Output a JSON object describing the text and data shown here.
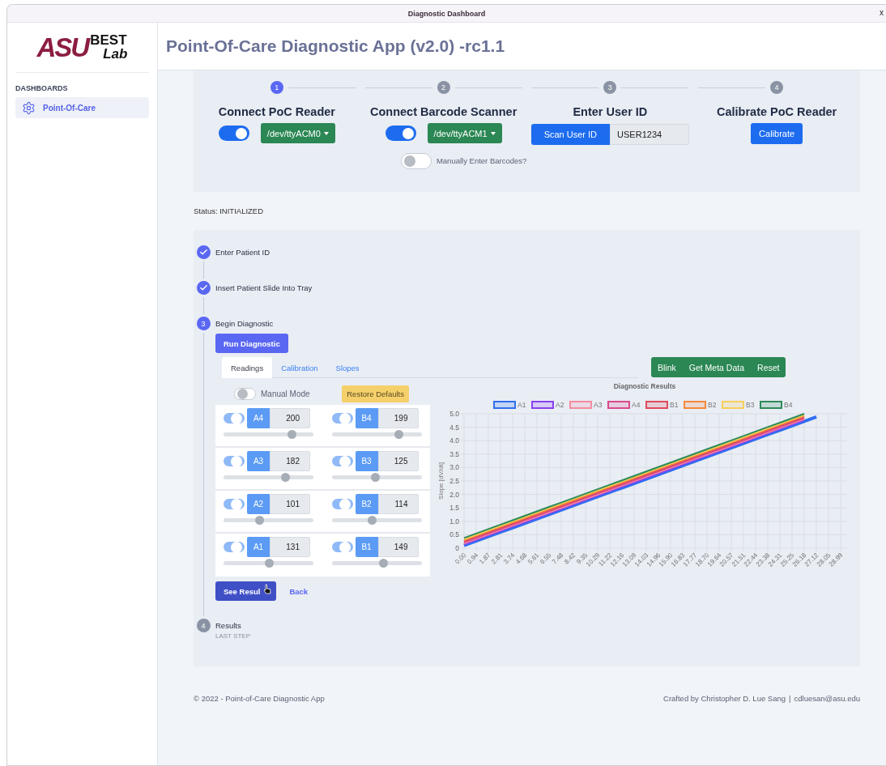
{
  "window": {
    "title": "Diagnostic Dashboard",
    "close": "x"
  },
  "sidebar": {
    "logo": {
      "parts": [
        "ASU",
        "BEST",
        "Lab"
      ]
    },
    "section": "DASHBOARDS",
    "items": [
      {
        "label": "Point-Of-Care",
        "selected": true
      }
    ]
  },
  "header": {
    "title": "Point-Of-Care Diagnostic App (v2.0) -rc1.1"
  },
  "setup_steps": [
    {
      "number": "1",
      "title": "Connect PoC Reader",
      "selected": true,
      "kind": "device",
      "toggle_on": true,
      "port": "/dev/ttyACM0"
    },
    {
      "number": "2",
      "title": "Connect Barcode Scanner",
      "selected": false,
      "kind": "device",
      "toggle_on": true,
      "port": "/dev/ttyACM1",
      "manual": {
        "label": "Manually Enter Barcodes?",
        "on": false
      }
    },
    {
      "number": "3",
      "title": "Enter User ID",
      "selected": false,
      "kind": "user",
      "button": "Scan User ID",
      "value": "USER1234"
    },
    {
      "number": "4",
      "title": "Calibrate PoC Reader",
      "selected": false,
      "kind": "calibrate",
      "button": "Calibrate"
    }
  ],
  "status": "Status: INITIALIZED",
  "progress": [
    {
      "label": "Enter Patient ID",
      "done": true,
      "active": false
    },
    {
      "label": "Insert Patient Slide Into Tray",
      "done": true,
      "active": false
    },
    {
      "number": "3",
      "label": "Begin Diagnostic",
      "done": false,
      "active": true
    },
    {
      "number": "4",
      "label": "Results",
      "sublabel": "LAST STEP",
      "done": false,
      "active": false
    }
  ],
  "diagnostic": {
    "run_button": "Run Diagnostic",
    "tabs": [
      {
        "label": "Readings",
        "selected": true
      },
      {
        "label": "Calibration",
        "selected": false
      },
      {
        "label": "Slopes",
        "selected": false
      }
    ],
    "actions": [
      "Blink",
      "Get Meta Data",
      "Reset"
    ],
    "manual_mode": {
      "label": "Manual Mode",
      "on": false
    },
    "restore_button": "Restore Defaults",
    "readings": [
      [
        {
          "name": "A4",
          "value": "200",
          "on": true,
          "level": 0.76
        },
        {
          "name": "B4",
          "value": "199",
          "on": true,
          "level": 0.75
        }
      ],
      [
        {
          "name": "A3",
          "value": "182",
          "on": true,
          "level": 0.69
        },
        {
          "name": "B3",
          "value": "125",
          "on": true,
          "level": 0.49
        }
      ],
      [
        {
          "name": "A2",
          "value": "101",
          "on": true,
          "level": 0.4
        },
        {
          "name": "B2",
          "value": "114",
          "on": true,
          "level": 0.45
        }
      ],
      [
        {
          "name": "A1",
          "value": "131",
          "on": true,
          "level": 0.51
        },
        {
          "name": "B1",
          "value": "149",
          "on": true,
          "level": 0.58
        }
      ]
    ],
    "see_results_button": "See Resul",
    "back_link": "Back",
    "chart_data": {
      "type": "line",
      "title": "Diagnostic Results",
      "ylabel": "Slope [dV/dt]",
      "categories": [
        "0.00",
        "0.94",
        "1.87",
        "2.81",
        "3.74",
        "4.68",
        "5.61",
        "6.55",
        "7.48",
        "8.42",
        "9.35",
        "10.29",
        "11.22",
        "12.16",
        "13.09",
        "14.03",
        "14.96",
        "15.90",
        "16.83",
        "17.77",
        "18.70",
        "19.64",
        "20.57",
        "21.51",
        "22.44",
        "23.38",
        "24.31",
        "25.25",
        "26.18",
        "27.12",
        "28.05",
        "28.99"
      ],
      "ylim": [
        0,
        5
      ],
      "grid": true,
      "legend": true,
      "yticks": [
        {
          "value": 0,
          "label": "0"
        },
        0.5,
        {
          "value": 1,
          "label": "1.0"
        },
        1.5,
        {
          "value": 2,
          "label": "2.0"
        },
        2.5,
        {
          "value": 3,
          "label": "3.0"
        },
        3.5,
        {
          "value": 4,
          "label": "4.0"
        },
        4.5,
        {
          "value": 5,
          "label": "5.0"
        }
      ],
      "series": [
        {
          "name": "A1",
          "color": "#2f6ff0",
          "values": [
            0.1,
            0.265,
            0.43,
            0.595,
            0.76,
            0.925,
            1.09,
            1.255,
            1.42,
            1.585,
            1.75,
            1.915,
            2.08,
            2.245,
            2.41,
            2.575,
            2.74,
            2.905,
            3.07,
            3.235,
            3.4,
            3.565,
            3.73,
            3.895,
            4.06,
            4.225,
            4.39,
            4.555,
            4.72,
            4.885,
            null,
            null
          ]
        },
        {
          "name": "A2",
          "color": "#8a3ff0",
          "values": [
            0.14,
            0.305,
            0.47,
            0.635,
            0.8,
            0.965,
            1.13,
            1.295,
            1.46,
            1.625,
            1.79,
            1.955,
            2.12,
            2.285,
            2.45,
            2.615,
            2.78,
            2.945,
            3.11,
            3.275,
            3.44,
            3.605,
            3.77,
            3.935,
            4.1,
            4.265,
            4.43,
            4.595,
            4.76,
            null,
            null,
            null
          ]
        },
        {
          "name": "A3",
          "color": "#f58ba0",
          "values": [
            0.18,
            0.345,
            0.51,
            0.675,
            0.84,
            1.005,
            1.17,
            1.335,
            1.5,
            1.665,
            1.83,
            1.995,
            2.16,
            2.325,
            2.49,
            2.655,
            2.82,
            2.985,
            3.15,
            3.315,
            3.48,
            3.645,
            3.81,
            3.975,
            4.14,
            4.305,
            4.47,
            4.635,
            4.8,
            null,
            null,
            null
          ]
        },
        {
          "name": "A4",
          "color": "#d94a8c",
          "values": [
            0.22,
            0.385,
            0.55,
            0.715,
            0.88,
            1.045,
            1.21,
            1.375,
            1.54,
            1.705,
            1.87,
            2.035,
            2.2,
            2.365,
            2.53,
            2.695,
            2.86,
            3.025,
            3.19,
            3.355,
            3.52,
            3.685,
            3.85,
            4.015,
            4.18,
            4.345,
            4.51,
            4.675,
            4.84,
            null,
            null,
            null
          ]
        },
        {
          "name": "B1",
          "color": "#e04a5c",
          "values": [
            0.26,
            0.425,
            0.59,
            0.755,
            0.92,
            1.085,
            1.25,
            1.415,
            1.58,
            1.745,
            1.91,
            2.075,
            2.24,
            2.405,
            2.57,
            2.735,
            2.9,
            3.065,
            3.23,
            3.395,
            3.56,
            3.725,
            3.89,
            4.055,
            4.22,
            4.385,
            4.55,
            4.715,
            4.88,
            null,
            null,
            null
          ]
        },
        {
          "name": "B2",
          "color": "#f5893c",
          "values": [
            0.3,
            0.465,
            0.63,
            0.795,
            0.96,
            1.125,
            1.29,
            1.455,
            1.62,
            1.785,
            1.95,
            2.115,
            2.28,
            2.445,
            2.61,
            2.775,
            2.94,
            3.105,
            3.27,
            3.435,
            3.6,
            3.765,
            3.93,
            4.095,
            4.26,
            4.425,
            4.59,
            4.755,
            4.92,
            null,
            null,
            null
          ]
        },
        {
          "name": "B3",
          "color": "#f8cf5a",
          "values": [
            0.34,
            0.505,
            0.67,
            0.835,
            1.0,
            1.165,
            1.33,
            1.495,
            1.66,
            1.825,
            1.99,
            2.155,
            2.32,
            2.485,
            2.65,
            2.815,
            2.98,
            3.145,
            3.31,
            3.475,
            3.64,
            3.805,
            3.97,
            4.135,
            4.3,
            4.465,
            4.63,
            4.795,
            4.96,
            null,
            null,
            null
          ]
        },
        {
          "name": "B4",
          "color": "#2e8b5a",
          "values": [
            0.38,
            0.545,
            0.71,
            0.875,
            1.04,
            1.205,
            1.37,
            1.535,
            1.7,
            1.865,
            2.03,
            2.195,
            2.36,
            2.525,
            2.69,
            2.855,
            3.02,
            3.185,
            3.35,
            3.515,
            3.68,
            3.845,
            4.01,
            4.175,
            4.34,
            4.505,
            4.67,
            4.835,
            5.0,
            null,
            null,
            null
          ]
        }
      ]
    }
  },
  "footer": {
    "left": "© 2022 - Point-of-Care Diagnostic App",
    "credit": "Crafted by Christopher D. Lue Sang",
    "separator": "|",
    "email": "cdluesan@asu.edu"
  }
}
